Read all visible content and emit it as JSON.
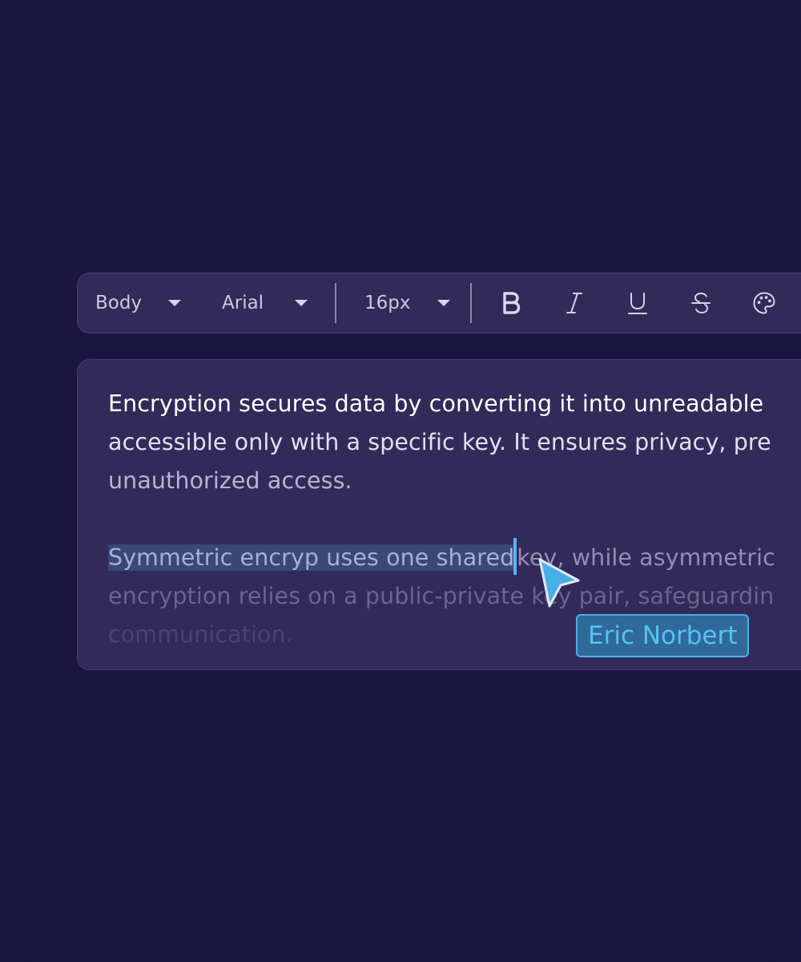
{
  "toolbar": {
    "style_select": {
      "value": "Body",
      "icon": "chevron-down-icon"
    },
    "font_select": {
      "value": "Arial",
      "icon": "chevron-down-icon"
    },
    "size_select": {
      "value": "16px",
      "icon": "chevron-down-icon"
    },
    "buttons": [
      {
        "name": "bold",
        "icon": "bold-icon"
      },
      {
        "name": "italic",
        "icon": "italic-icon"
      },
      {
        "name": "underline",
        "icon": "underline-icon"
      },
      {
        "name": "strikethrough",
        "icon": "strikethrough-icon"
      },
      {
        "name": "text-color",
        "icon": "palette-icon"
      }
    ]
  },
  "editor": {
    "paragraph1": {
      "line1": "Encryption secures data by converting it into unreadable",
      "line2": "accessible only with a specific key. It ensures privacy, pre",
      "line3": "unauthorized access."
    },
    "paragraph2": {
      "line1_selected": "Symmetric encryp uses one shared",
      "line1_rest": "key, while asymmetric",
      "line2": "encryption relies on a public-private key pair, safeguardin",
      "line3": "communication."
    }
  },
  "collaborator": {
    "name": "Eric Norbert",
    "icon": "pointer-cursor-icon"
  },
  "colors": {
    "background": "#1b1542",
    "panel": "#322a58",
    "panel_border": "#463f70",
    "selection": "#3b4679",
    "accent": "#4fb0e6",
    "name_tag_bg": "#2f6a9a"
  }
}
